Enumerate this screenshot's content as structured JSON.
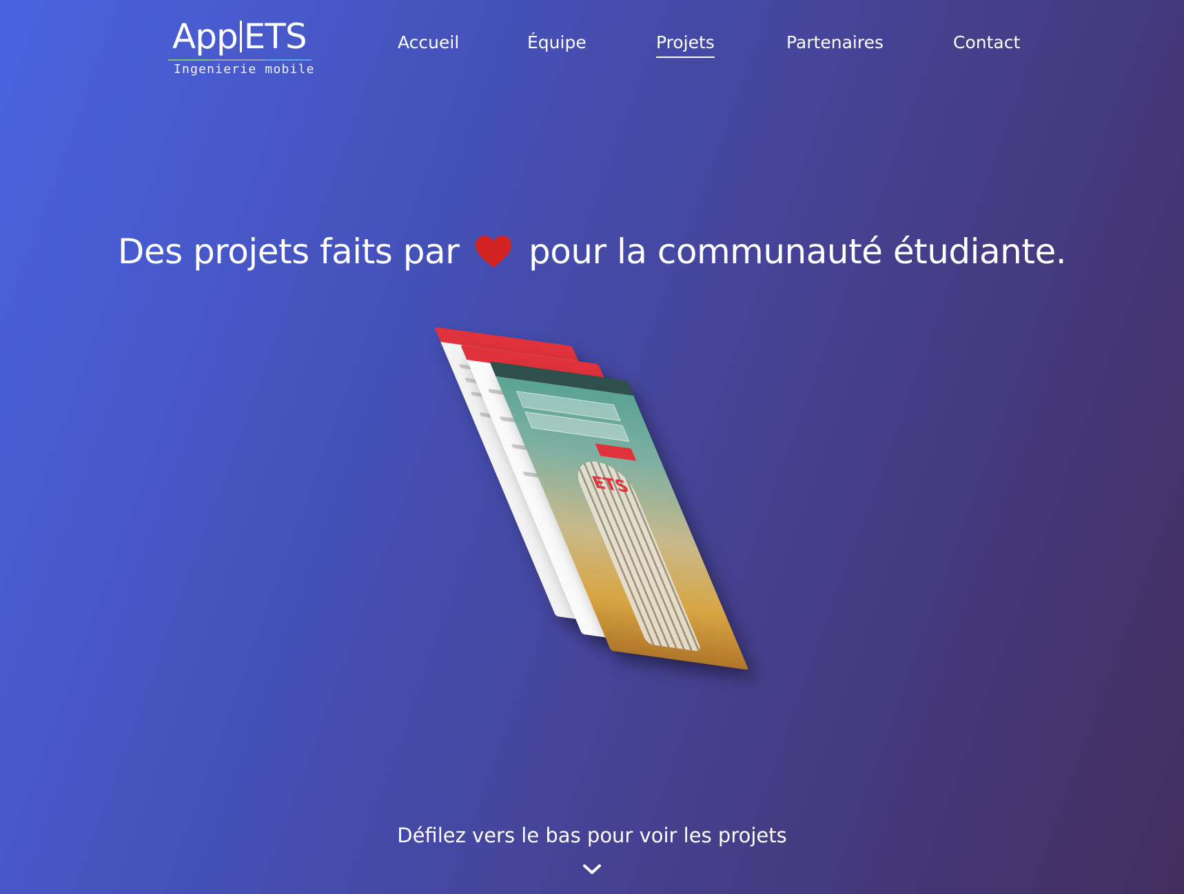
{
  "logo": {
    "title_left": "App",
    "title_right": "ETS",
    "subtitle": "Ingenierie mobile"
  },
  "nav": {
    "items": [
      {
        "label": "Accueil",
        "active": false
      },
      {
        "label": "Équipe",
        "active": false
      },
      {
        "label": "Projets",
        "active": true
      },
      {
        "label": "Partenaires",
        "active": false
      },
      {
        "label": "Contact",
        "active": false
      }
    ]
  },
  "hero": {
    "headline_before": "Des projets faits par",
    "headline_after": "pour la communauté étudiante.",
    "heart_icon": "heart-icon",
    "heart_color": "#d42323",
    "mockup_icon": "app-screens-mockup",
    "mockup_sign": "ETS"
  },
  "scroll": {
    "hint": "Défilez vers le bas pour voir les projets",
    "icon": "chevron-down-icon"
  },
  "colors": {
    "gradient_start": "#4a63e0",
    "gradient_end": "#432e5e",
    "accent_red": "#e0323b"
  }
}
